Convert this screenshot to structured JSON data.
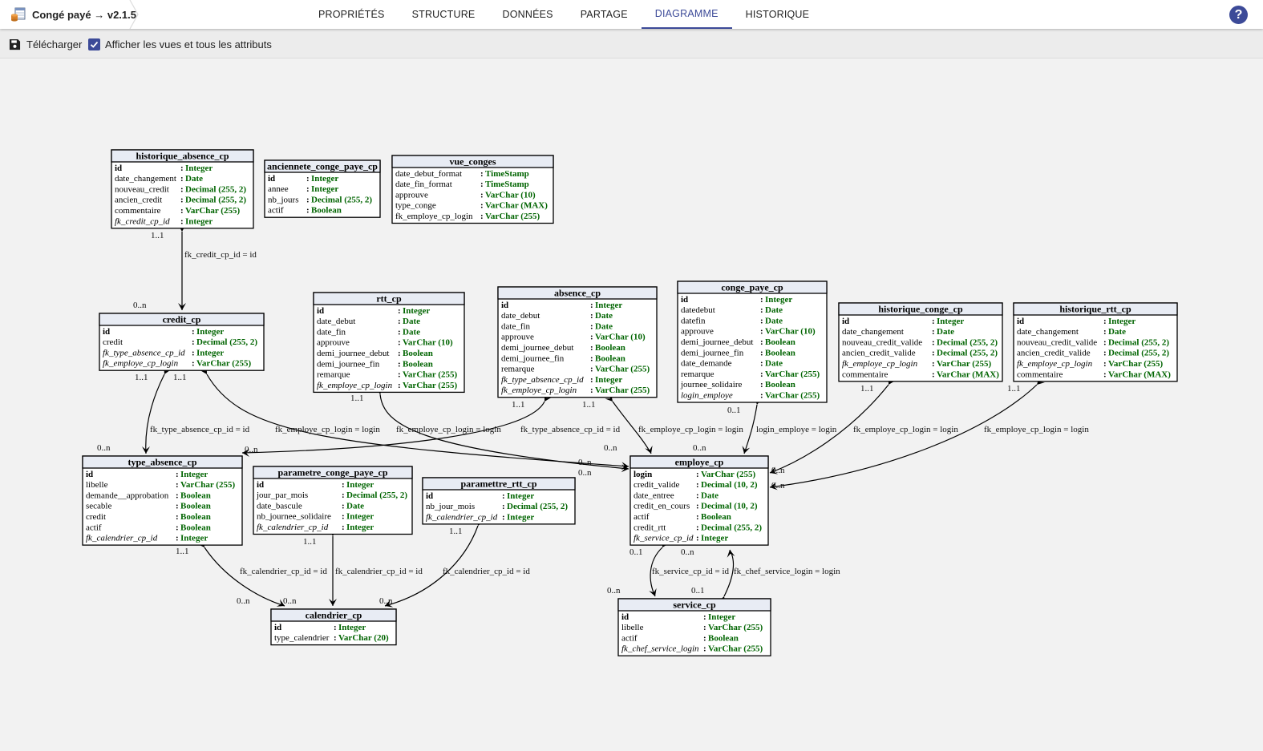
{
  "app": {
    "title": "Congé payé → v2.1.5",
    "icon": "database-table-icon"
  },
  "tabs": [
    "PROPRIÉTÉS",
    "STRUCTURE",
    "DONNÉES",
    "PARTAGE",
    "DIAGRAMME",
    "HISTORIQUE"
  ],
  "active_tab": "DIAGRAMME",
  "help": {
    "label": "?",
    "icon": "help-circle-icon"
  },
  "toolbar": {
    "download_label": "Télécharger",
    "download_icon": "save-disk-icon",
    "show_views_label": "Afficher les vues et tous les attributs",
    "show_views_checked": true
  },
  "colors": {
    "accent": "#3c4a98",
    "entity_header": "#e8ecf4",
    "type_text": "#006400",
    "line": "#000000",
    "canvas": "#f2f2f2"
  },
  "diagram": {
    "entities": [
      {
        "id": "historique_absence_cp",
        "name": "historique_absence_cp",
        "attrs": [
          {
            "n": "id",
            "t": "Integer",
            "pk": true
          },
          {
            "n": "date_changement",
            "t": "Date"
          },
          {
            "n": "nouveau_credit",
            "t": "Decimal (255, 2)"
          },
          {
            "n": "ancien_credit",
            "t": "Decimal (255, 2)"
          },
          {
            "n": "commentaire",
            "t": "VarChar (255)"
          },
          {
            "n": "fk_credit_cp_id",
            "t": "Integer",
            "fk": true
          }
        ]
      },
      {
        "id": "anciennete_conge_paye_cp",
        "name": "anciennete_conge_paye_cp",
        "attrs": [
          {
            "n": "id",
            "t": "Integer",
            "pk": true
          },
          {
            "n": "annee",
            "t": "Integer"
          },
          {
            "n": "nb_jours",
            "t": "Decimal (255, 2)"
          },
          {
            "n": "actif",
            "t": "Boolean"
          }
        ]
      },
      {
        "id": "vue_conges",
        "name": "vue_conges",
        "attrs": [
          {
            "n": "date_debut_format",
            "t": "TimeStamp"
          },
          {
            "n": "date_fin_format",
            "t": "TimeStamp"
          },
          {
            "n": "approuve",
            "t": "VarChar (10)"
          },
          {
            "n": "type_conge",
            "t": "VarChar (MAX)"
          },
          {
            "n": "fk_employe_cp_login",
            "t": "VarChar (255)"
          }
        ]
      },
      {
        "id": "credit_cp",
        "name": "credit_cp",
        "attrs": [
          {
            "n": "id",
            "t": "Integer",
            "pk": true
          },
          {
            "n": "credit",
            "t": "Decimal (255, 2)"
          },
          {
            "n": "fk_type_absence_cp_id",
            "t": "Integer",
            "fk": true
          },
          {
            "n": "fk_employe_cp_login",
            "t": "VarChar (255)",
            "fk": true
          }
        ]
      },
      {
        "id": "rtt_cp",
        "name": "rtt_cp",
        "attrs": [
          {
            "n": "id",
            "t": "Integer",
            "pk": true
          },
          {
            "n": "date_debut",
            "t": "Date"
          },
          {
            "n": "date_fin",
            "t": "Date"
          },
          {
            "n": "approuve",
            "t": "VarChar (10)"
          },
          {
            "n": "demi_journee_debut",
            "t": "Boolean"
          },
          {
            "n": "demi_journee_fin",
            "t": "Boolean"
          },
          {
            "n": "remarque",
            "t": "VarChar (255)"
          },
          {
            "n": "fk_employe_cp_login",
            "t": "VarChar (255)",
            "fk": true
          }
        ]
      },
      {
        "id": "absence_cp",
        "name": "absence_cp",
        "attrs": [
          {
            "n": "id",
            "t": "Integer",
            "pk": true
          },
          {
            "n": "date_debut",
            "t": "Date"
          },
          {
            "n": "date_fin",
            "t": "Date"
          },
          {
            "n": "approuve",
            "t": "VarChar (10)"
          },
          {
            "n": "demi_journee_debut",
            "t": "Boolean"
          },
          {
            "n": "demi_journee_fin",
            "t": "Boolean"
          },
          {
            "n": "remarque",
            "t": "VarChar (255)"
          },
          {
            "n": "fk_type_absence_cp_id",
            "t": "Integer",
            "fk": true
          },
          {
            "n": "fk_employe_cp_login",
            "t": "VarChar (255)",
            "fk": true
          }
        ]
      },
      {
        "id": "conge_paye_cp",
        "name": "conge_paye_cp",
        "attrs": [
          {
            "n": "id",
            "t": "Integer",
            "pk": true
          },
          {
            "n": "datedebut",
            "t": "Date"
          },
          {
            "n": "datefin",
            "t": "Date"
          },
          {
            "n": "approuve",
            "t": "VarChar (10)"
          },
          {
            "n": "demi_journee_debut",
            "t": "Boolean"
          },
          {
            "n": "demi_journee_fin",
            "t": "Boolean"
          },
          {
            "n": "date_demande",
            "t": "Date"
          },
          {
            "n": "remarque",
            "t": "VarChar (255)"
          },
          {
            "n": "journee_solidaire",
            "t": "Boolean"
          },
          {
            "n": "login_employe",
            "t": "VarChar (255)",
            "fk": true
          }
        ]
      },
      {
        "id": "historique_conge_cp",
        "name": "historique_conge_cp",
        "attrs": [
          {
            "n": "id",
            "t": "Integer",
            "pk": true
          },
          {
            "n": "date_changement",
            "t": "Date"
          },
          {
            "n": "nouveau_credit_valide",
            "t": "Decimal (255, 2)"
          },
          {
            "n": "ancien_credit_valide",
            "t": "Decimal (255, 2)"
          },
          {
            "n": "fk_employe_cp_login",
            "t": "VarChar (255)",
            "fk": true
          },
          {
            "n": "commentaire",
            "t": "VarChar (MAX)"
          }
        ]
      },
      {
        "id": "historique_rtt_cp",
        "name": "historique_rtt_cp",
        "attrs": [
          {
            "n": "id",
            "t": "Integer",
            "pk": true
          },
          {
            "n": "date_changement",
            "t": "Date"
          },
          {
            "n": "nouveau_credit_valide",
            "t": "Decimal (255, 2)"
          },
          {
            "n": "ancien_credit_valide",
            "t": "Decimal (255, 2)"
          },
          {
            "n": "fk_employe_cp_login",
            "t": "VarChar (255)",
            "fk": true
          },
          {
            "n": "commentaire",
            "t": "VarChar (MAX)"
          }
        ]
      },
      {
        "id": "type_absence_cp",
        "name": "type_absence_cp",
        "attrs": [
          {
            "n": "id",
            "t": "Integer",
            "pk": true
          },
          {
            "n": "libelle",
            "t": "VarChar (255)"
          },
          {
            "n": "demande__approbation",
            "t": "Boolean"
          },
          {
            "n": "secable",
            "t": "Boolean"
          },
          {
            "n": "credit",
            "t": "Boolean"
          },
          {
            "n": "actif",
            "t": "Boolean"
          },
          {
            "n": "fk_calendrier_cp_id",
            "t": "Integer",
            "fk": true
          }
        ]
      },
      {
        "id": "parametre_conge_paye_cp",
        "name": "parametre_conge_paye_cp",
        "attrs": [
          {
            "n": "id",
            "t": "Integer",
            "pk": true
          },
          {
            "n": "jour_par_mois",
            "t": "Decimal (255, 2)"
          },
          {
            "n": "date_bascule",
            "t": "Date"
          },
          {
            "n": "nb_journee_solidaire",
            "t": "Integer"
          },
          {
            "n": "fk_calendrier_cp_id",
            "t": "Integer",
            "fk": true
          }
        ]
      },
      {
        "id": "paramettre_rtt_cp",
        "name": "paramettre_rtt_cp",
        "attrs": [
          {
            "n": "id",
            "t": "Integer",
            "pk": true
          },
          {
            "n": "nb_jour_mois",
            "t": "Decimal (255, 2)"
          },
          {
            "n": "fk_calendrier_cp_id",
            "t": "Integer",
            "fk": true
          }
        ]
      },
      {
        "id": "employe_cp",
        "name": "employe_cp",
        "attrs": [
          {
            "n": "login",
            "t": "VarChar (255)",
            "pk": true
          },
          {
            "n": "credit_valide",
            "t": "Decimal (10, 2)"
          },
          {
            "n": "date_entree",
            "t": "Date"
          },
          {
            "n": "credit_en_cours",
            "t": "Decimal (10, 2)"
          },
          {
            "n": "actif",
            "t": "Boolean"
          },
          {
            "n": "credit_rtt",
            "t": "Decimal (255, 2)"
          },
          {
            "n": "fk_service_cp_id",
            "t": "Integer",
            "fk": true
          }
        ]
      },
      {
        "id": "calendrier_cp",
        "name": "calendrier_cp",
        "attrs": [
          {
            "n": "id",
            "t": "Integer",
            "pk": true
          },
          {
            "n": "type_calendrier",
            "t": "VarChar (20)"
          }
        ]
      },
      {
        "id": "service_cp",
        "name": "service_cp",
        "attrs": [
          {
            "n": "id",
            "t": "Integer",
            "pk": true
          },
          {
            "n": "libelle",
            "t": "VarChar (255)"
          },
          {
            "n": "actif",
            "t": "Boolean"
          },
          {
            "n": "fk_chef_service_login",
            "t": "VarChar (255)",
            "fk": true
          }
        ]
      }
    ],
    "relations": [
      {
        "from": "historique_absence_cp",
        "to": "credit_cp",
        "label": "fk_credit_cp_id = id",
        "card_from": "1..1",
        "card_to": "0..n"
      },
      {
        "from": "credit_cp",
        "to": "type_absence_cp",
        "label": "fk_type_absence_cp_id = id",
        "card_from": "1..1",
        "card_to": "0..n"
      },
      {
        "from": "credit_cp",
        "to": "employe_cp",
        "label": "fk_employe_cp_login = login",
        "card_from": "1..1",
        "card_to": "0..n"
      },
      {
        "from": "rtt_cp",
        "to": "employe_cp",
        "label": "fk_employe_cp_login = login",
        "card_from": "1..1",
        "card_to": "0..n"
      },
      {
        "from": "absence_cp",
        "to": "type_absence_cp",
        "label": "fk_type_absence_cp_id = id",
        "card_from": "1..1",
        "card_to": "0..n"
      },
      {
        "from": "absence_cp",
        "to": "employe_cp",
        "label": "fk_employe_cp_login = login",
        "card_from": "1..1",
        "card_to": "0..n"
      },
      {
        "from": "conge_paye_cp",
        "to": "employe_cp",
        "label": "login_employe = login",
        "card_from": "0..1",
        "card_to": "0..n"
      },
      {
        "from": "historique_conge_cp",
        "to": "employe_cp",
        "label": "fk_employe_cp_login = login",
        "card_from": "1..1",
        "card_to": "0..n"
      },
      {
        "from": "historique_rtt_cp",
        "to": "employe_cp",
        "label": "fk_employe_cp_login = login",
        "card_from": "1..1",
        "card_to": "0..n"
      },
      {
        "from": "type_absence_cp",
        "to": "calendrier_cp",
        "label": "fk_calendrier_cp_id = id",
        "card_from": "1..1",
        "card_to": "0..n"
      },
      {
        "from": "parametre_conge_paye_cp",
        "to": "calendrier_cp",
        "label": "fk_calendrier_cp_id = id",
        "card_from": "1..1",
        "card_to": "0..n"
      },
      {
        "from": "paramettre_rtt_cp",
        "to": "calendrier_cp",
        "label": "fk_calendrier_cp_id = id",
        "card_from": "1..1",
        "card_to": "0..n"
      },
      {
        "from": "employe_cp",
        "to": "service_cp",
        "label": "fk_service_cp_id = id",
        "card_from": "0..1",
        "card_to": "0..n"
      },
      {
        "from": "service_cp",
        "to": "employe_cp",
        "label": "fk_chef_service_login = login",
        "card_from": "0..1",
        "card_to": "0..n"
      }
    ]
  }
}
